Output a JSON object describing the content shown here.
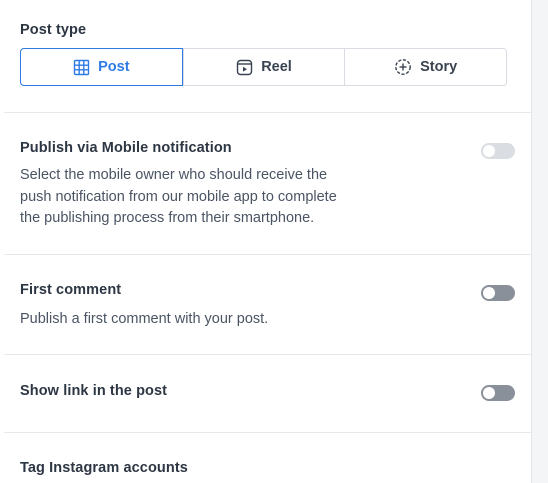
{
  "post_type": {
    "heading": "Post type",
    "options": [
      {
        "label": "Post",
        "icon": "grid-icon",
        "selected": true
      },
      {
        "label": "Reel",
        "icon": "reel-play-icon",
        "selected": false
      },
      {
        "label": "Story",
        "icon": "story-plus-icon",
        "selected": false
      }
    ],
    "accent_color": "#2f7be6"
  },
  "mobile_notification": {
    "heading": "Publish via Mobile notification",
    "description_lines": [
      "Select the mobile owner who should receive the",
      "push notification from our mobile app to complete",
      "the publishing process from their smartphone."
    ],
    "enabled": false
  },
  "first_comment": {
    "heading": "First comment",
    "description": "Publish a first comment with your post.",
    "enabled": false
  },
  "show_link": {
    "heading": "Show link in the post",
    "enabled": false
  },
  "tag_accounts": {
    "heading": "Tag Instagram accounts"
  }
}
